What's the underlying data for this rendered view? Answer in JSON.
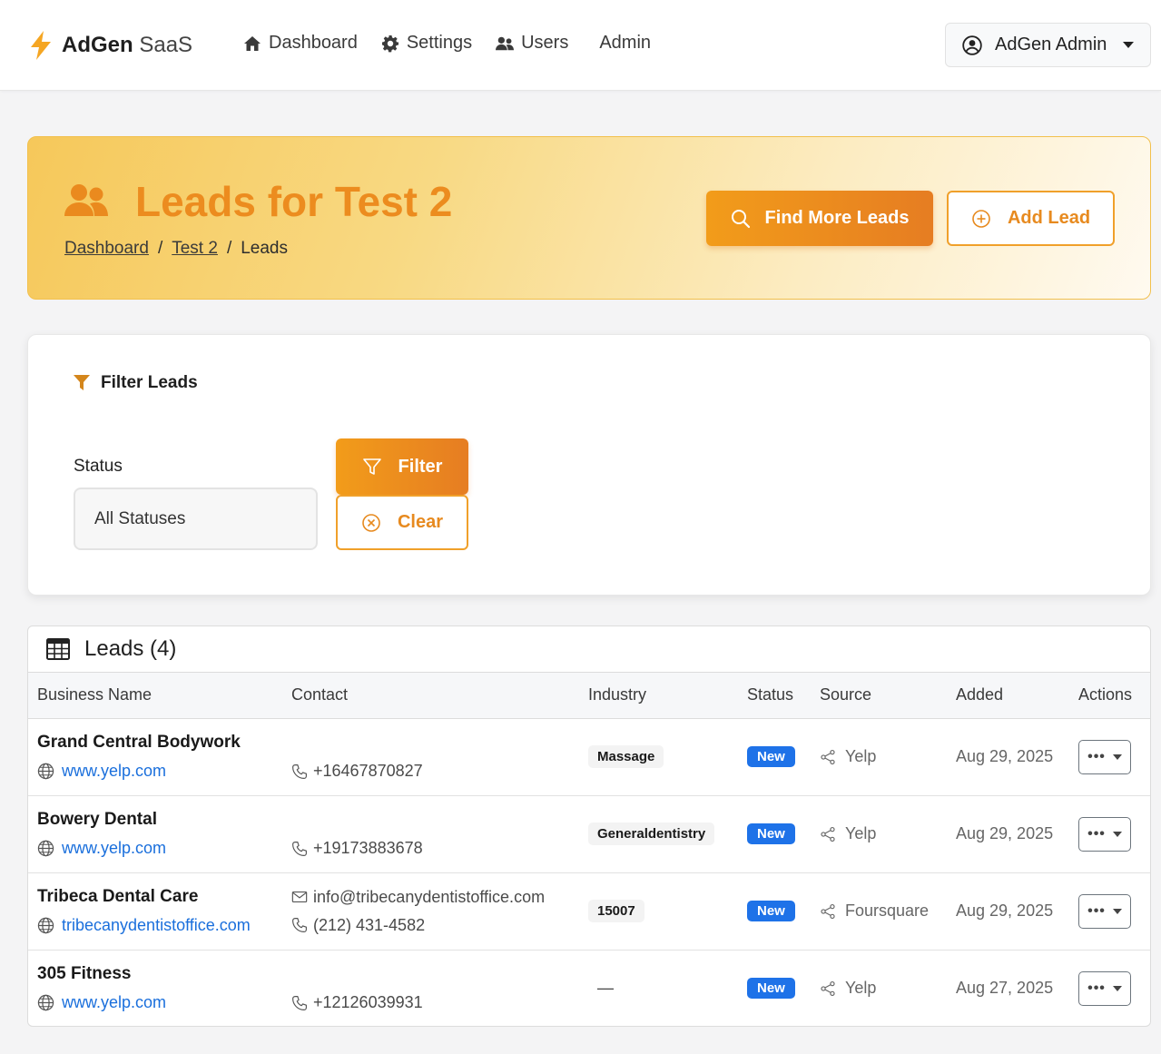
{
  "brand": {
    "name": "AdGen",
    "suffix": "SaaS",
    "accent": "#f5a623"
  },
  "nav": {
    "items": [
      {
        "label": "Dashboard",
        "icon": "home-icon"
      },
      {
        "label": "Settings",
        "icon": "gear-icon"
      },
      {
        "label": "Users",
        "icon": "users-icon"
      },
      {
        "label": "Admin",
        "icon": ""
      }
    ],
    "user": {
      "label": "AdGen Admin",
      "icon": "user-circle-icon"
    }
  },
  "hero": {
    "title": "Leads for Test 2",
    "breadcrumbs": [
      "Dashboard",
      "Test 2",
      "Leads"
    ],
    "find_button": "Find More Leads",
    "add_button": "Add Lead"
  },
  "filter": {
    "heading": "Filter Leads",
    "status_label": "Status",
    "status_value": "All Statuses",
    "filter_button": "Filter",
    "clear_button": "Clear"
  },
  "leads": {
    "heading": "Leads (4)",
    "columns": [
      "Business Name",
      "Contact",
      "Industry",
      "Status",
      "Source",
      "Added",
      "Actions"
    ],
    "rows": [
      {
        "name": "Grand Central Bodywork",
        "website": "www.yelp.com",
        "email": "",
        "phone": "+16467870827",
        "industry": "Massage",
        "status": "New",
        "source": "Yelp",
        "added": "Aug 29, 2025"
      },
      {
        "name": "Bowery Dental",
        "website": "www.yelp.com",
        "email": "",
        "phone": "+19173883678",
        "industry": "Generaldentistry",
        "status": "New",
        "source": "Yelp",
        "added": "Aug 29, 2025"
      },
      {
        "name": "Tribeca Dental Care",
        "website": "tribecanydentistoffice.com",
        "email": "info@tribecanydentistoffice.com",
        "phone": "(212) 431-4582",
        "industry": "15007",
        "status": "New",
        "source": "Foursquare",
        "added": "Aug 29, 2025"
      },
      {
        "name": "305 Fitness",
        "website": "www.yelp.com",
        "email": "",
        "phone": "+12126039931",
        "industry": "—",
        "status": "New",
        "source": "Yelp",
        "added": "Aug 27, 2025"
      }
    ],
    "action_dots": "•••"
  }
}
